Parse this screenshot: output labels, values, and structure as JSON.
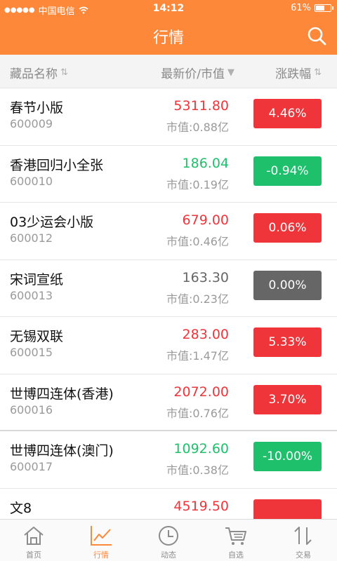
{
  "status": {
    "carrier": "中国电信",
    "time": "14:12",
    "battery": "61%",
    "battery_level": 0.61
  },
  "header": {
    "title": "行情"
  },
  "columns": {
    "name": "藏品名称",
    "price": "最新价/市值",
    "change": "涨跌幅"
  },
  "colors": {
    "brand": "#fd8839",
    "up": "#f0353a",
    "down": "#1fc06b",
    "flat": "#666666"
  },
  "items": [
    {
      "name": "春节小版",
      "code": "600009",
      "price": "5311.80",
      "cap": "市值:0.88亿",
      "change": "4.46%",
      "trend": "up"
    },
    {
      "name": "香港回归小全张",
      "code": "600010",
      "price": "186.04",
      "cap": "市值:0.19亿",
      "change": "-0.94%",
      "trend": "down"
    },
    {
      "name": "03少运会小版",
      "code": "600012",
      "price": "679.00",
      "cap": "市值:0.46亿",
      "change": "0.06%",
      "trend": "up"
    },
    {
      "name": "宋词宣纸",
      "code": "600013",
      "price": "163.30",
      "cap": "市值:0.23亿",
      "change": "0.00%",
      "trend": "flat"
    },
    {
      "name": "无锡双联",
      "code": "600015",
      "price": "283.00",
      "cap": "市值:1.47亿",
      "change": "5.33%",
      "trend": "up"
    },
    {
      "name": "世博四连体(香港)",
      "code": "600016",
      "price": "2072.00",
      "cap": "市值:0.76亿",
      "change": "3.70%",
      "trend": "up"
    },
    {
      "name": "世博四连体(澳门)",
      "code": "600017",
      "price": "1092.60",
      "cap": "市值:0.38亿",
      "change": "-10.00%",
      "trend": "down"
    },
    {
      "name": "文8",
      "code": "",
      "price": "4519.50",
      "cap": "",
      "change": "",
      "trend": "up"
    }
  ],
  "tabs": [
    {
      "label": "首页",
      "icon": "home-icon",
      "active": false
    },
    {
      "label": "行情",
      "icon": "chart-line-icon",
      "active": true
    },
    {
      "label": "动态",
      "icon": "clock-icon",
      "active": false
    },
    {
      "label": "自选",
      "icon": "cart-icon",
      "active": false
    },
    {
      "label": "交易",
      "icon": "transfer-arrows-icon",
      "active": false
    }
  ]
}
